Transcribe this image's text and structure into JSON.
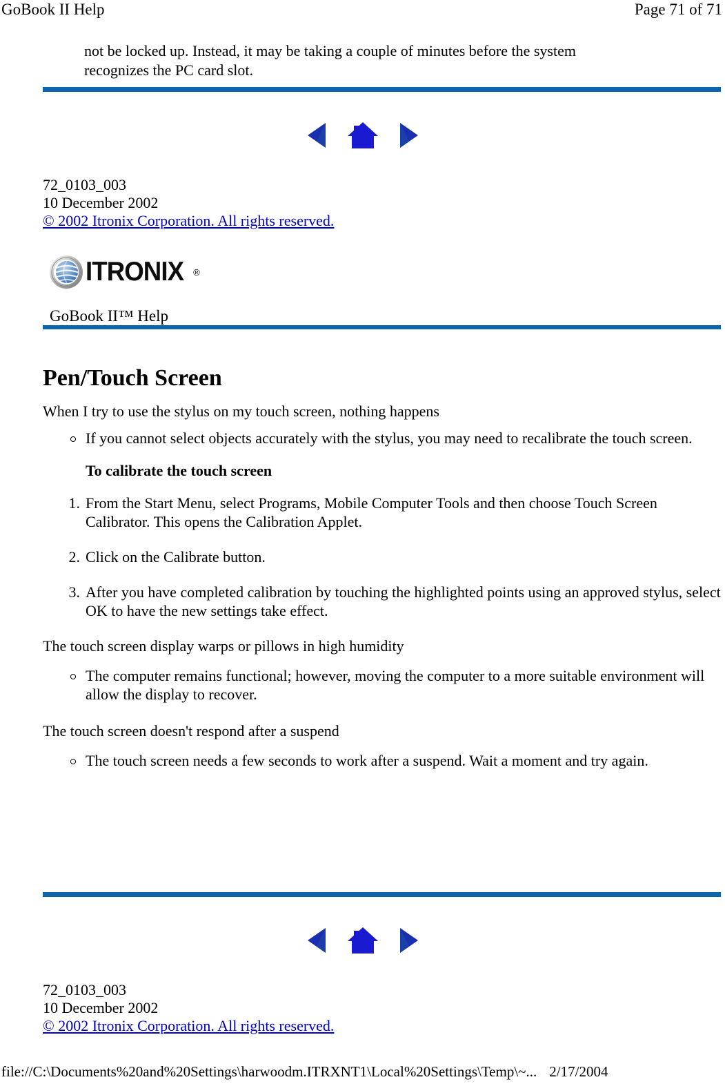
{
  "header": {
    "doc_title": "GoBook II Help",
    "page_indicator": "Page 71 of 71"
  },
  "continuation_paragraph": "not be locked up.  Instead, it may be taking a couple of minutes before the system recognizes the PC card slot.",
  "navigation": {
    "previous_label": "previous-page",
    "home_label": "home-page",
    "next_label": "next-page"
  },
  "footer_top": {
    "doc_number": "72_0103_003",
    "date": "10 December 2002",
    "copyright": "© 2002 Itronix Corporation.  All rights reserved."
  },
  "logo": {
    "wordmark": "ITRONIX",
    "registered_mark": "®"
  },
  "product_title": "GoBook II™ Help",
  "main_heading": "Pen/Touch Screen",
  "sections": [
    {
      "question": "When I try to use the stylus on my touch screen, nothing happens",
      "bullets": [
        "If you cannot select objects accurately with the stylus, you may need to recalibrate the touch screen."
      ],
      "sub_heading": "To calibrate the touch screen",
      "steps": [
        {
          "num": "1.",
          "text": "From the Start Menu, select Programs, Mobile Computer Tools and then choose Touch Screen Calibrator.  This opens the Calibration Applet."
        },
        {
          "num": "2.",
          "text": "Click on the Calibrate button."
        },
        {
          "num": "3.",
          "text": "After you have completed calibration by touching the highlighted points using an approved stylus, select OK to have the new settings take effect."
        }
      ]
    },
    {
      "question": "The touch screen display warps or pillows in high humidity",
      "bullets": [
        "The computer remains functional; however, moving the computer to a more suitable environment will allow the display to recover."
      ]
    },
    {
      "question": "The touch screen doesn't respond after a suspend",
      "bullets": [
        "The touch screen needs a few seconds to work after a suspend.  Wait a moment and try again."
      ]
    }
  ],
  "footer_bottom": {
    "doc_number": "72_0103_003",
    "date": "10 December 2002",
    "copyright": "© 2002 Itronix Corporation.  All rights reserved."
  },
  "status_bar": {
    "file_path": "file://C:\\Documents%20and%20Settings\\harwoodm.ITRXNT1\\Local%20Settings\\Temp\\~...",
    "print_date": "2/17/2004"
  },
  "colors": {
    "rule_blue": "#0a64ae",
    "link_blue": "#0000cc",
    "nav_icon_blue": "#1f1fd0",
    "nav_icon_dark": "#14348c"
  }
}
